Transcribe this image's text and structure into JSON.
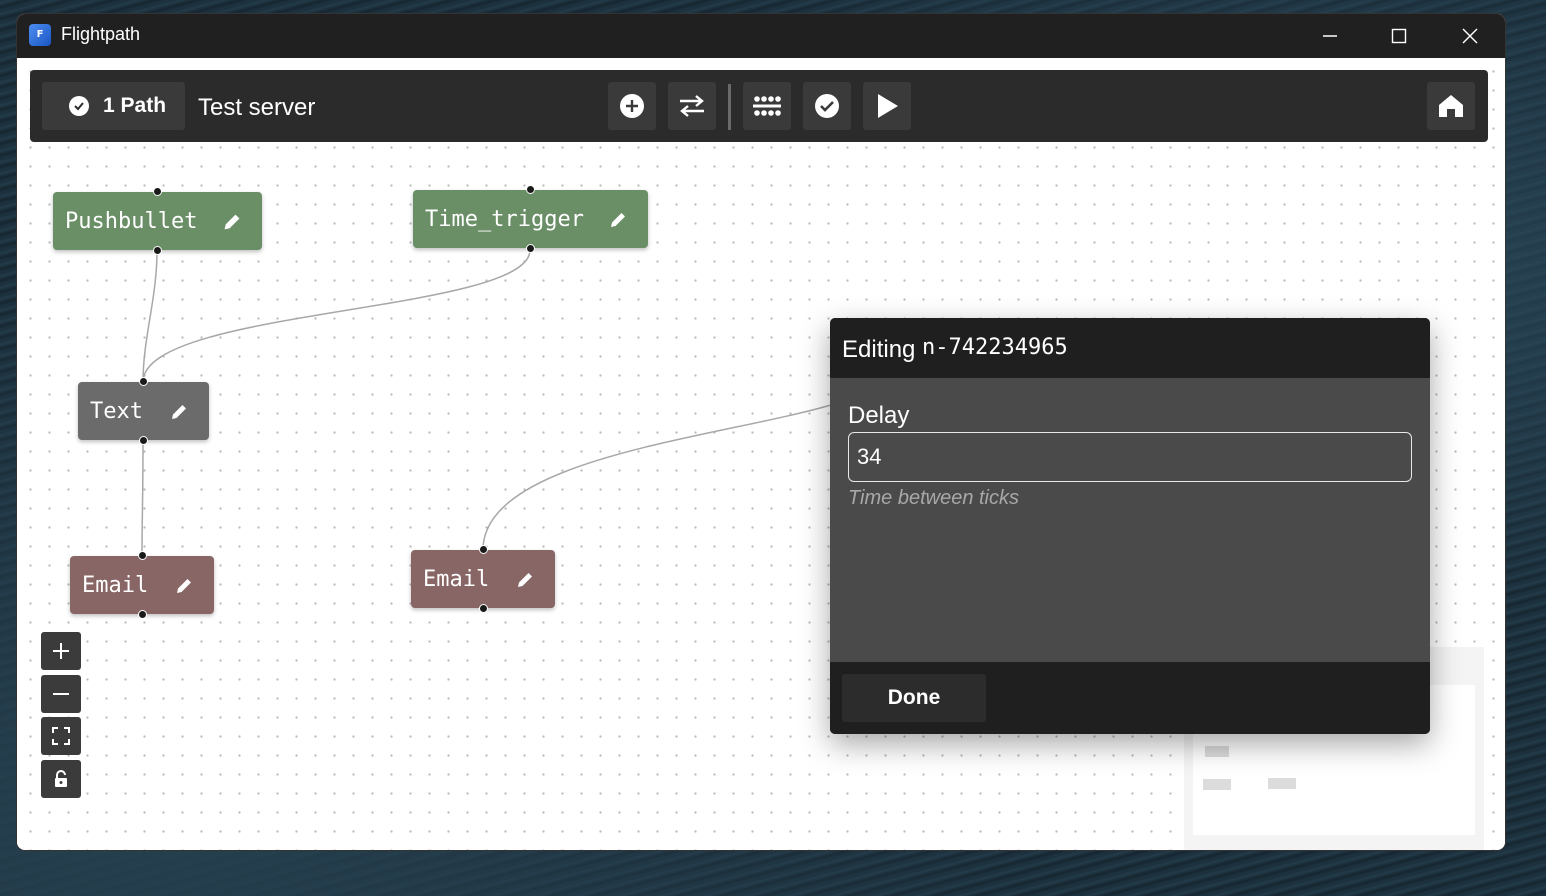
{
  "window": {
    "title": "Flightpath",
    "icon": "app-logo-icon"
  },
  "window_controls": [
    "minimize-icon",
    "maximize-icon",
    "close-icon"
  ],
  "toolbar": {
    "path_badge": "1 Path",
    "server_name": "Test server",
    "buttons": [
      "add-node-icon",
      "swap-arrows-icon",
      "grid-layout-icon",
      "validate-check-icon",
      "play-icon"
    ],
    "home_button": "home-icon"
  },
  "nodes": [
    {
      "id": "pushbullet",
      "label": "Pushbullet",
      "color": "#6a8f67"
    },
    {
      "id": "time_trigger",
      "label": "Time_trigger",
      "color": "#6a8f67"
    },
    {
      "id": "text",
      "label": "Text",
      "color": "#6b6b6b"
    },
    {
      "id": "email1",
      "label": "Email",
      "color": "#896666"
    },
    {
      "id": "email2",
      "label": "Email",
      "color": "#896666"
    }
  ],
  "zoom_controls": [
    "zoom-in-icon",
    "zoom-out-icon",
    "fit-view-icon",
    "lock-icon"
  ],
  "dialog": {
    "title_prefix": "Editing",
    "node_id": "n-742234965",
    "field_label": "Delay",
    "field_value": "34",
    "field_help": "Time between ticks",
    "done_label": "Done"
  }
}
